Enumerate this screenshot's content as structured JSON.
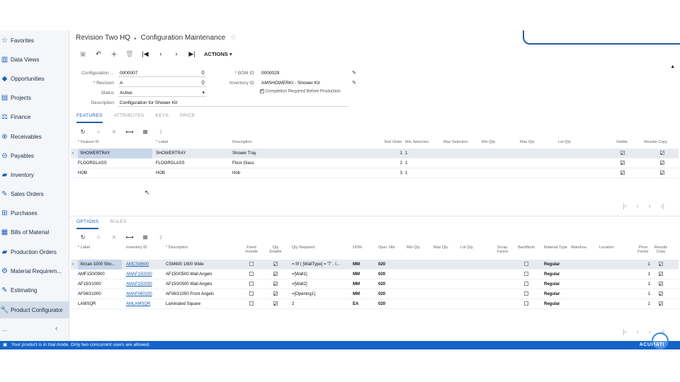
{
  "sidebar": {
    "items": [
      {
        "label": "Favorites",
        "icon": "star-icon",
        "glyph": "☆"
      },
      {
        "label": "Data Views",
        "icon": "chart-icon",
        "glyph": "▥"
      },
      {
        "label": "Opportunities",
        "icon": "tag-icon",
        "glyph": "◆"
      },
      {
        "label": "Projects",
        "icon": "projects-icon",
        "glyph": "▤"
      },
      {
        "label": "Finance",
        "icon": "scale-icon",
        "glyph": "⚖"
      },
      {
        "label": "Receivables",
        "icon": "plus-circle-icon",
        "glyph": "⊕"
      },
      {
        "label": "Payables",
        "icon": "minus-circle-icon",
        "glyph": "⊖"
      },
      {
        "label": "Inventory",
        "icon": "truck-icon",
        "glyph": "▰"
      },
      {
        "label": "Sales Orders",
        "icon": "edit-icon",
        "glyph": "✎"
      },
      {
        "label": "Purchases",
        "icon": "cart-icon",
        "glyph": "⊞"
      },
      {
        "label": "Bills of Material",
        "icon": "bom-icon",
        "glyph": "▦"
      },
      {
        "label": "Production Orders",
        "icon": "production-icon",
        "glyph": "▰"
      },
      {
        "label": "Material Requirem...",
        "icon": "material-icon",
        "glyph": "⚙"
      },
      {
        "label": "Estimating",
        "icon": "pencil-icon",
        "glyph": "✎"
      },
      {
        "label": "Product Configurator",
        "icon": "wrench-icon",
        "glyph": "🔧"
      }
    ],
    "more": "...",
    "collapse": "‹"
  },
  "header": {
    "company": "Revision Two HQ",
    "separator": "▸",
    "title": "Configuration Maintenance"
  },
  "toolbar": {
    "actions_label": "ACTIONS ▾"
  },
  "form": {
    "configuration_label": "Configuration ...",
    "configuration_value": "0000007",
    "revision_label": "* Revision",
    "revision_value": "A",
    "status_label": "Status",
    "status_value": "Active",
    "description_label": "Description",
    "description_value": "Configuration for Shower Kit",
    "bom_label": "* BOM ID",
    "bom_value": "0000029",
    "inventory_label": "Inventory ID",
    "inventory_value": "AMSHOWERKI - Shower Kit",
    "completion_label": "Completion Required Before Production",
    "completion_checked": true
  },
  "top_tabs": [
    "FEATURES",
    "ATTRIBUTES",
    "KEYS",
    "PRICE"
  ],
  "features": {
    "headers": {
      "feature_id": "* Feature ID",
      "label": "* Label",
      "description": "Description",
      "sort_order": "Sort Order",
      "min_sel": "Min Selection",
      "max_sel": "Max Selection",
      "min_qty": "Min Qty",
      "max_qty": "Max Qty",
      "lot_qty": "Lot Qty",
      "visible": "Visible",
      "results_copy": "Results Copy"
    },
    "rows": [
      {
        "feature_id": "SHOWERTRAY",
        "label": "SHOWERTRAY",
        "description": "Shower Tray",
        "sort_order": "1",
        "min_sel": "1",
        "visible": true,
        "results_copy": true
      },
      {
        "feature_id": "FLOORGLASS",
        "label": "FLOORGLASS",
        "description": "Floor Glass",
        "sort_order": "2",
        "min_sel": "1",
        "visible": true,
        "results_copy": true
      },
      {
        "feature_id": "HOB",
        "label": "HOB",
        "description": "Hob",
        "sort_order": "3",
        "min_sel": "1",
        "visible": true,
        "results_copy": true
      }
    ]
  },
  "bottom_tabs": [
    "OPTIONS",
    "RULES"
  ],
  "options": {
    "headers": {
      "label": "* Label",
      "inventory_id": "Inventory ID",
      "description": "* Description",
      "fixed_include": "Fixed Include",
      "qty_enabled": "Qty Enable",
      "qty_required": "Qty Required",
      "uom": "UOM",
      "oper_nbr": "Oper. Nbr",
      "min_qty": "Min Qty",
      "max_qty": "Max Qty",
      "lot_qty": "Lot Qty",
      "scrap_factor": "Scrap Factor",
      "backflush": "Backflush",
      "material_type": "Material Type",
      "warehouse": "Warehou",
      "location": "Location",
      "price_factor": "Price Factor",
      "results_copy": "Results Copy"
    },
    "rows": [
      {
        "label": "Xircan 1000 Sho...",
        "inventory_id": "AMCSM600",
        "description": "CSM600 1600 Wide",
        "fixed": false,
        "qty_enabled": true,
        "qty_required": "= IIf ( [WallType] = 'T' , I...",
        "uom": "MM",
        "oper": "020",
        "backflush": false,
        "material_type": "Regular",
        "price_factor": "1",
        "results_copy": true
      },
      {
        "label": "AMF150/0900",
        "inventory_id": "AMAF150030",
        "description": "AF150/0500 Wall Angels",
        "fixed": false,
        "qty_enabled": true,
        "qty_required": "=[Wall1]",
        "uom": "MM",
        "oper": "020",
        "backflush": false,
        "material_type": "Regular",
        "price_factor": "1",
        "results_copy": true
      },
      {
        "label": "AF150/1000",
        "inventory_id": "AMAF150030",
        "description": "AF150/0500 Wall Angels",
        "fixed": false,
        "qty_enabled": true,
        "qty_required": "=[Wall2]",
        "uom": "MM",
        "oper": "020",
        "backflush": false,
        "material_type": "Regular",
        "price_factor": "1",
        "results_copy": true
      },
      {
        "label": "AF060/1000",
        "inventory_id": "AMAF060100",
        "description": "AF060/1050 Front Angels",
        "fixed": false,
        "qty_enabled": true,
        "qty_required": "=[Opening1]",
        "uom": "MM",
        "oper": "020",
        "backflush": false,
        "material_type": "Regular",
        "price_factor": "1",
        "results_copy": true
      },
      {
        "label": "LAMSQR",
        "inventory_id": "AMLAMSQR",
        "description": "Laminated Square",
        "fixed": false,
        "qty_enabled": true,
        "qty_required": "2",
        "uom": "EA",
        "oper": "020",
        "backflush": false,
        "material_type": "Regular",
        "price_factor": "1",
        "results_copy": true
      }
    ]
  },
  "status": {
    "message": "Your product is in trial mode. Only two concurrent users are allowed.",
    "logo": "ACUMATI"
  },
  "colors": {
    "accent": "#1c5fb4",
    "status_bar": "#1563c9"
  }
}
